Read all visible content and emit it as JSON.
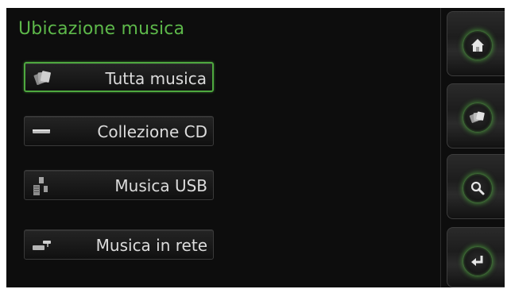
{
  "header": {
    "title": "Ubicazione musica"
  },
  "menu": {
    "items": [
      {
        "label": "Tutta musica",
        "icon": "music-cards-icon",
        "selected": true
      },
      {
        "label": "Collezione CD",
        "icon": "cd-slot-icon",
        "selected": false
      },
      {
        "label": "Musica USB",
        "icon": "usb-device-icon",
        "selected": false
      },
      {
        "label": "Musica in rete",
        "icon": "network-icon",
        "selected": false
      }
    ]
  },
  "sidebar": {
    "buttons": [
      {
        "icon": "home-icon"
      },
      {
        "icon": "music-cards-icon"
      },
      {
        "icon": "search-icon"
      },
      {
        "icon": "back-arrow-icon"
      }
    ]
  },
  "colors": {
    "accent": "#5db84a",
    "background": "#0d0d0d",
    "button_text": "#dcdcdc"
  }
}
